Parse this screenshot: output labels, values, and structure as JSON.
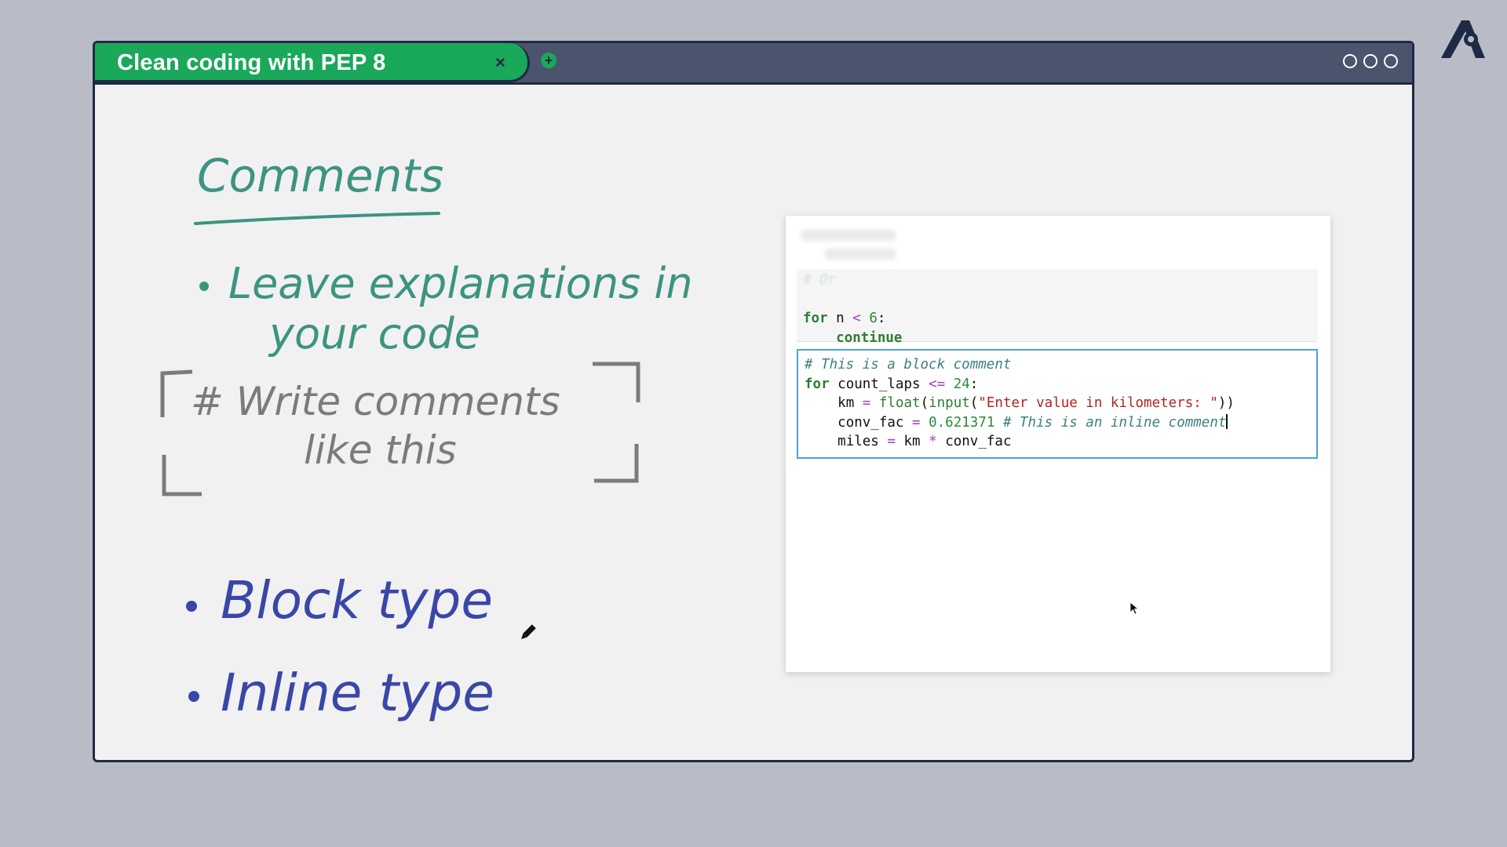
{
  "window": {
    "tab_title": "Clean coding with PEP 8",
    "tab_close_glyph": "×",
    "new_tab_glyph": "+"
  },
  "whiteboard": {
    "heading": "Comments",
    "bullet_1_line_1": "Leave explanations in",
    "bullet_1_line_2": "your code",
    "example_line_1": "# Write comments",
    "example_line_2": "like this",
    "bullet_2": "Block type",
    "bullet_3": "Inline type",
    "colors": {
      "green_ink": "#3c9480",
      "gray_ink": "#7b7b7b",
      "blue_ink": "#3a47a6"
    }
  },
  "code_panel": {
    "faded_line": "# Or",
    "prev_cell": {
      "line1": {
        "kw": "for",
        "name": "n",
        "op": "<",
        "num": "6",
        "colon": ":"
      },
      "line2": {
        "kw": "continue"
      }
    },
    "active_cell": {
      "comment": "# This is a block comment",
      "line2": {
        "kw": "for",
        "name": "count_laps",
        "op": "<=",
        "num": "24",
        "colon": ":"
      },
      "line3": {
        "name": "km",
        "eq": "=",
        "fn1": "float",
        "p1": "(",
        "fn2": "input",
        "p2": "(",
        "str": "\"Enter value in kilometers: \"",
        "p3": "))"
      },
      "line4": {
        "name": "conv_fac",
        "eq": "=",
        "num": "0.621371",
        "comment": "# This is an inline comment"
      },
      "line5": {
        "name": "miles",
        "eq": "=",
        "name2": "km",
        "op": "*",
        "name3": "conv_fac"
      }
    }
  },
  "icons": {
    "logo": "brand-logo-icon",
    "pencil": "pencil-cursor-icon",
    "pointer": "mouse-pointer-icon"
  }
}
